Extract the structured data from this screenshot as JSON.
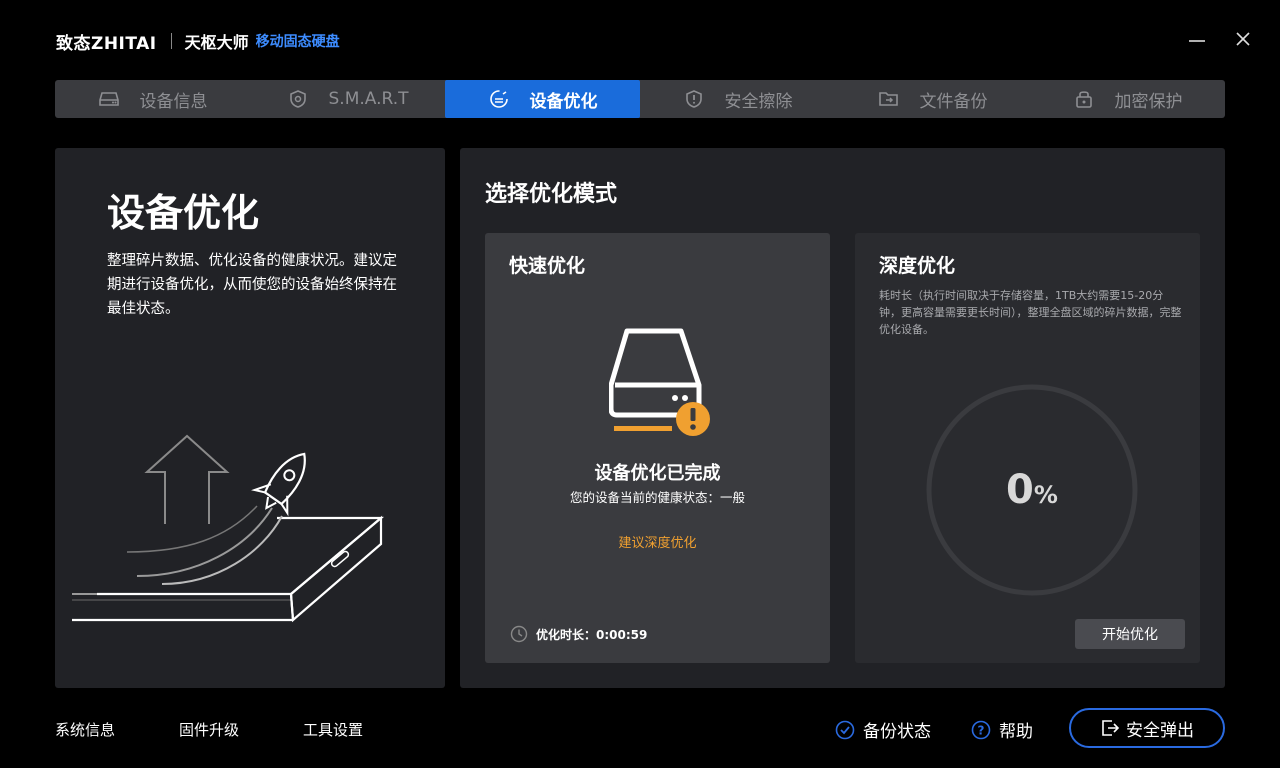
{
  "header": {
    "logo": "致态ZHITAI",
    "app_name": "天枢大师",
    "product": "移动固态硬盘"
  },
  "tabs": [
    {
      "label": "设备信息",
      "icon": "drive-icon"
    },
    {
      "label": "S.M.A.R.T",
      "icon": "shield-icon"
    },
    {
      "label": "设备优化",
      "icon": "optimize-icon",
      "active": true
    },
    {
      "label": "安全擦除",
      "icon": "alert-shield-icon"
    },
    {
      "label": "文件备份",
      "icon": "folder-icon"
    },
    {
      "label": "加密保护",
      "icon": "lock-icon"
    }
  ],
  "left": {
    "title": "设备优化",
    "description": "整理碎片数据、优化设备的健康状况。建议定期进行设备优化，从而使您的设备始终保持在最佳状态。"
  },
  "right": {
    "title": "选择优化模式",
    "quick": {
      "title": "快速优化",
      "status": "设备优化已完成",
      "health": "您的设备当前的健康状态：一般",
      "suggest": "建议深度优化",
      "time_label": "优化时长：0:00:59"
    },
    "deep": {
      "title": "深度优化",
      "description": "耗时长（执行时间取决于存储容量，1TB大约需要15-20分钟，更高容量需要更长时间），整理全盘区域的碎片数据，完整优化设备。",
      "progress": 0,
      "progress_num": "0",
      "progress_unit": "%",
      "start_label": "开始优化"
    }
  },
  "footer": {
    "system_info": "系统信息",
    "firmware": "固件升级",
    "settings": "工具设置",
    "backup_status": "备份状态",
    "help": "帮助",
    "eject": "安全弹出"
  },
  "colors": {
    "accent": "#1a6cdb",
    "warning": "#f0a030",
    "panel": "#212226",
    "card": "#3a3b3f"
  }
}
